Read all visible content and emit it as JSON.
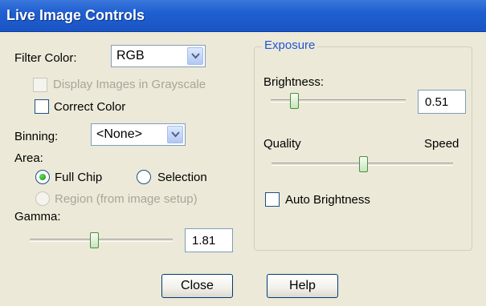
{
  "window": {
    "title": "Live Image Controls"
  },
  "filter_color": {
    "label": "Filter Color:",
    "value": "RGB"
  },
  "display_grayscale": {
    "label": "Display Images in Grayscale",
    "checked": false,
    "enabled": false
  },
  "correct_color": {
    "label": "Correct Color",
    "checked": false
  },
  "binning": {
    "label": "Binning:",
    "value": "<None>"
  },
  "area": {
    "label": "Area:",
    "options": [
      {
        "label": "Full Chip",
        "selected": true,
        "enabled": true
      },
      {
        "label": "Selection",
        "selected": false,
        "enabled": true
      },
      {
        "label": "Region (from image setup)",
        "selected": false,
        "enabled": false
      }
    ]
  },
  "gamma": {
    "label": "Gamma:",
    "value": "1.81",
    "slider_fraction": 0.45
  },
  "exposure": {
    "group_label": "Exposure",
    "brightness_label": "Brightness:",
    "brightness_value": "0.51",
    "brightness_fraction": 0.18,
    "quality_label": "Quality",
    "speed_label": "Speed",
    "quality_speed_fraction": 0.5,
    "auto_brightness": {
      "label": "Auto Brightness",
      "checked": false
    }
  },
  "buttons": {
    "close": "Close",
    "help": "Help"
  },
  "colors": {
    "titlebar": "#1f5fd0",
    "dialog_bg": "#ece9d8",
    "group_label": "#2056d2",
    "disabled_text": "#a7a69a"
  },
  "icons": {
    "dropdown": "chevron-down-icon",
    "slider_thumb": "slider-thumb"
  }
}
